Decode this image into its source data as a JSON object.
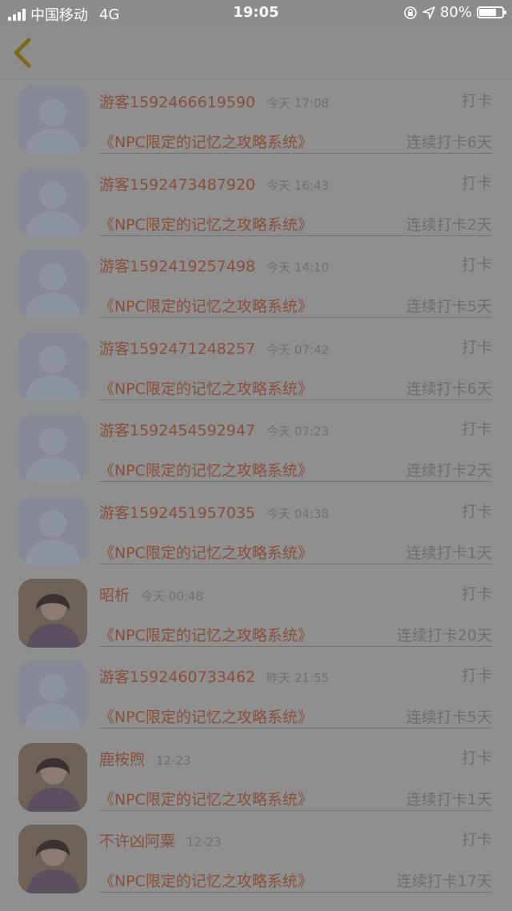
{
  "status_bar": {
    "carrier": "中国移动",
    "network": "4G",
    "time": "19:05",
    "battery": "80%",
    "battery_level": 0.8
  },
  "rows": [
    {
      "name": "游客1592466619590",
      "time": "今天 17:08",
      "action": "打卡",
      "title": "《NPC限定的记忆之攻略系统》",
      "streak": "连续打卡6天",
      "avatar": "default-avatar"
    },
    {
      "name": "游客1592473487920",
      "time": "今天 16:43",
      "action": "打卡",
      "title": "《NPC限定的记忆之攻略系统》",
      "streak": "连续打卡2天",
      "avatar": "default-avatar"
    },
    {
      "name": "游客1592419257498",
      "time": "今天 14:10",
      "action": "打卡",
      "title": "《NPC限定的记忆之攻略系统》",
      "streak": "连续打卡5天",
      "avatar": "default-avatar"
    },
    {
      "name": "游客1592471248257",
      "time": "今天 07:42",
      "action": "打卡",
      "title": "《NPC限定的记忆之攻略系统》",
      "streak": "连续打卡6天",
      "avatar": "default-avatar"
    },
    {
      "name": "游客1592454592947",
      "time": "今天 07:23",
      "action": "打卡",
      "title": "《NPC限定的记忆之攻略系统》",
      "streak": "连续打卡2天",
      "avatar": "default-avatar"
    },
    {
      "name": "游客1592451957035",
      "time": "今天 04:38",
      "action": "打卡",
      "title": "《NPC限定的记忆之攻略系统》",
      "streak": "连续打卡1天",
      "avatar": "default-avatar"
    },
    {
      "name": "昭析",
      "time": "今天 00:48",
      "action": "打卡",
      "title": "《NPC限定的记忆之攻略系统》",
      "streak": "连续打卡20天",
      "avatar": "photo-avatar"
    },
    {
      "name": "游客1592460733462",
      "time": "昨天 21:55",
      "action": "打卡",
      "title": "《NPC限定的记忆之攻略系统》",
      "streak": "连续打卡5天",
      "avatar": "default-avatar"
    },
    {
      "name": "鹿桉煦",
      "time": "12-23",
      "action": "打卡",
      "title": "《NPC限定的记忆之攻略系统》",
      "streak": "连续打卡1天",
      "avatar": "photo-avatar"
    },
    {
      "name": "不许凶阿粟",
      "time": "12-23",
      "action": "打卡",
      "title": "《NPC限定的记忆之攻略系统》",
      "streak": "连续打卡17天",
      "avatar": "photo-avatar"
    }
  ],
  "colors": {
    "accent": "#8a4f3a",
    "back_arrow": "#7a6a1e",
    "overlay": "#8f8f8f"
  }
}
